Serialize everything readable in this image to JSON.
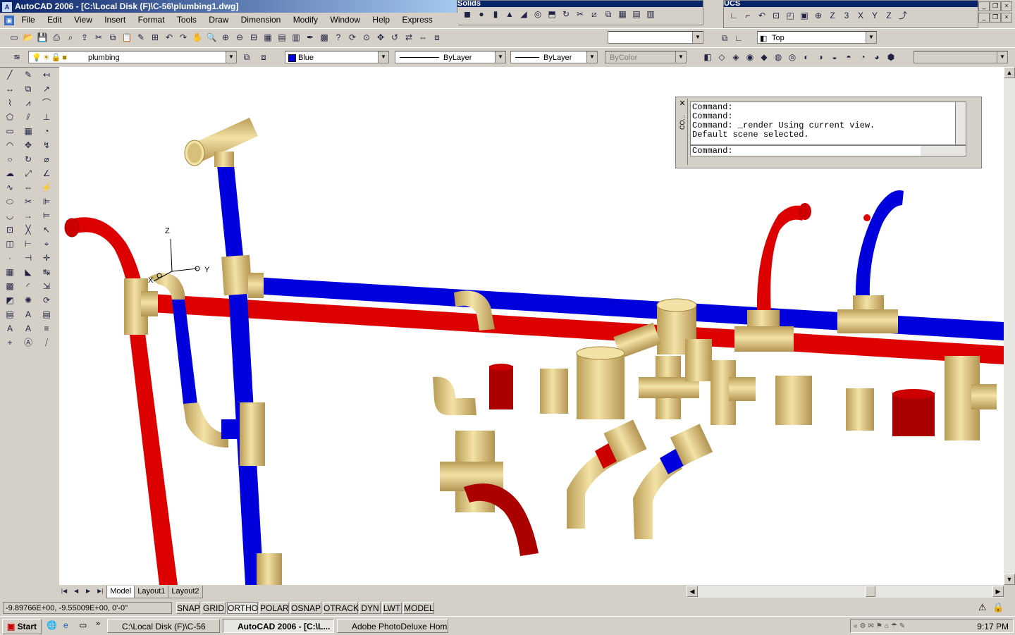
{
  "window": {
    "title": "AutoCAD 2006 - [C:\\Local Disk (F)\\C-56\\plumbing1.dwg]"
  },
  "menu": [
    "File",
    "Edit",
    "View",
    "Insert",
    "Format",
    "Tools",
    "Draw",
    "Dimension",
    "Modify",
    "Window",
    "Help",
    "Express"
  ],
  "floating_toolbars": {
    "solids_title": "Solids",
    "ucs_title": "UCS"
  },
  "view_combo": {
    "value": "Top"
  },
  "layer_combo": {
    "value": "plumbing"
  },
  "color_combo": {
    "value": "Blue"
  },
  "linetype_combo": {
    "value": "ByLayer"
  },
  "lineweight_combo": {
    "value": "ByLayer"
  },
  "plotstyle_combo": {
    "value": "ByColor"
  },
  "ucs_icon": {
    "z": "Z",
    "y": "Y",
    "x": "X"
  },
  "command_window": {
    "lines": [
      "Command:",
      "Command:",
      "Command: _render Using current view.",
      "Default scene selected."
    ],
    "prompt": "Command:",
    "side_label": "CO..."
  },
  "layout_tabs": [
    "Model",
    "Layout1",
    "Layout2"
  ],
  "status": {
    "coords": "-9.89766E+00, -9.55009E+00, 0'-0\"",
    "toggles": [
      "SNAP",
      "GRID",
      "ORTHO",
      "POLAR",
      "OSNAP",
      "OTRACK",
      "DYN",
      "LWT",
      "MODEL"
    ]
  },
  "taskbar": {
    "start": "Start",
    "tasks": [
      "C:\\Local Disk (F)\\C-56",
      "AutoCAD 2006 - [C:\\L...",
      "Adobe PhotoDeluxe Hom..."
    ],
    "clock": "9:17 PM"
  },
  "colors": {
    "pipe_red": "#dd0000",
    "pipe_blue": "#0000dd",
    "fitting": "#e8d28f",
    "dark_red": "#990000"
  }
}
